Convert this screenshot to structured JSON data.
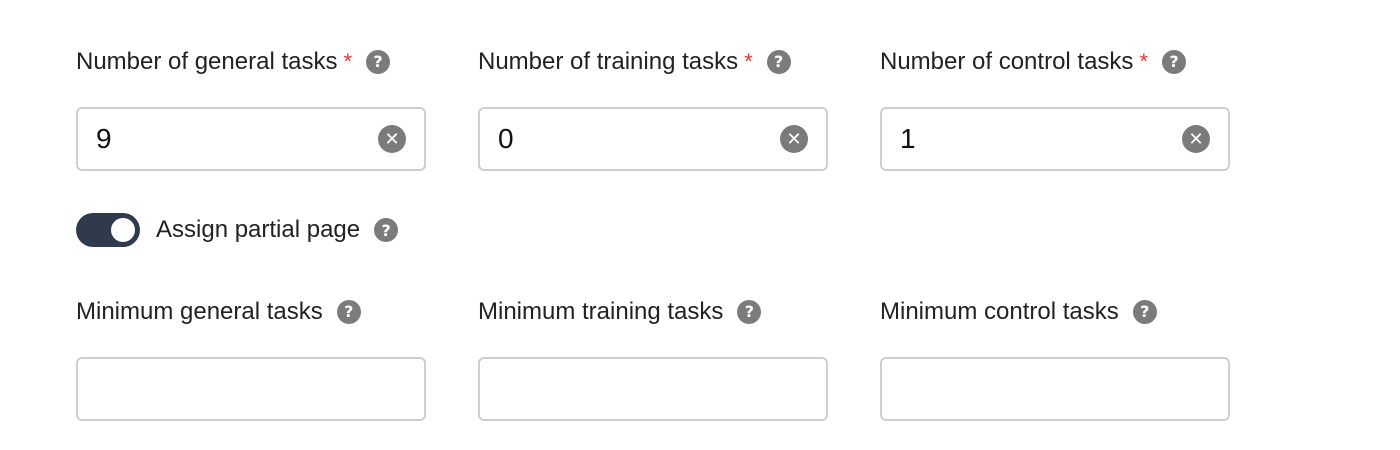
{
  "top_fields": [
    {
      "label": "Number of general tasks",
      "required": "*",
      "value": "9",
      "help": "?",
      "clear": "✕"
    },
    {
      "label": "Number of training tasks",
      "required": "*",
      "value": "0",
      "help": "?",
      "clear": "✕"
    },
    {
      "label": "Number of control tasks",
      "required": "*",
      "value": "1",
      "help": "?",
      "clear": "✕"
    }
  ],
  "toggle": {
    "label": "Assign partial page",
    "state": "on",
    "help": "?"
  },
  "bottom_fields": [
    {
      "label": "Minimum general tasks",
      "value": "",
      "help": "?"
    },
    {
      "label": "Minimum training tasks",
      "value": "",
      "help": "?"
    },
    {
      "label": "Minimum control tasks",
      "value": "",
      "help": "?"
    }
  ],
  "colors": {
    "required": "#e53935",
    "toggle_on": "#2f3b4c",
    "help_icon": "#7b7b7b",
    "input_border": "#cfcfcf"
  },
  "icons": {
    "help": "question-circle-icon",
    "clear": "clear-circle-icon"
  }
}
